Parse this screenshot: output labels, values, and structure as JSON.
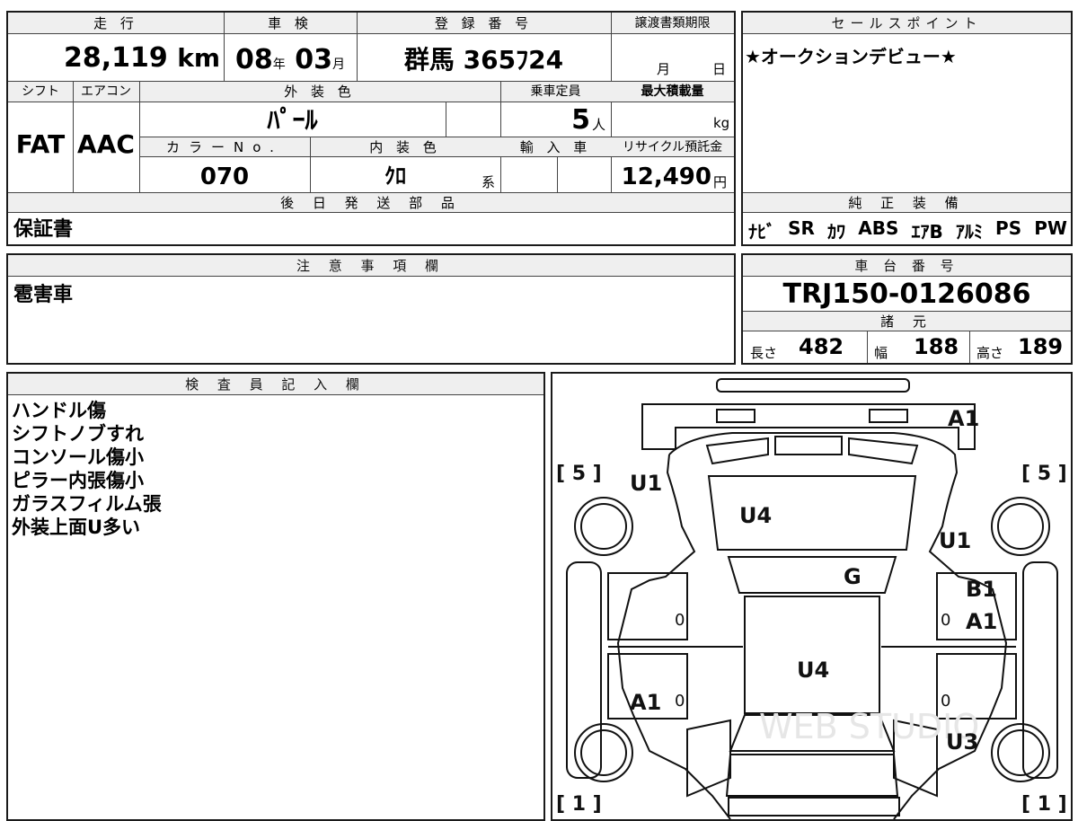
{
  "summary": {
    "mileage_label": "走 行",
    "mileage_value": "28,119",
    "mileage_unit": "km",
    "inspection_label": "車 検",
    "inspection_year": "08",
    "inspection_year_unit": "年",
    "inspection_month": "03",
    "inspection_month_unit": "月",
    "registration_label": "登 録 番 号",
    "registration_value": "群馬 365ﾌ24",
    "transfer_label": "譲渡書類期限",
    "transfer_month_unit": "月",
    "transfer_day_unit": "日"
  },
  "specs": {
    "shift_label": "シフト",
    "shift_value": "FAT",
    "aircon_label": "エアコン",
    "aircon_value": "AAC",
    "exterior_label": "外 装 色",
    "exterior_value": "ﾊﾟｰﾙ",
    "color_no_label": "カラーNo.",
    "color_no_value": "070",
    "interior_label": "内 装 色",
    "interior_value": "ｸﾛ",
    "interior_suffix": "系",
    "capacity_label": "乗車定員",
    "capacity_value": "5",
    "capacity_unit": "人",
    "max_load_label": "最大積載量",
    "max_load_unit": "kg",
    "import_label": "輸 入 車",
    "recycle_label": "リサイクル預託金",
    "recycle_value": "12,490",
    "recycle_unit": "円"
  },
  "sales_point": {
    "title": "セールスポイント",
    "text": "★オークションデビュー★"
  },
  "later_parts": {
    "title": "後 日 発 送 部 品",
    "text": "保証書"
  },
  "equipment": {
    "title": "純 正 装 備",
    "items": [
      "ﾅﾋﾞ",
      "SR",
      "ｶﾜ",
      "ABS",
      "ｴｱB",
      "ｱﾙﾐ",
      "PS",
      "PW"
    ]
  },
  "caution": {
    "title": "注 意 事 項 欄",
    "text": "雹害車"
  },
  "chassis": {
    "title": "車 台 番 号",
    "value": "TRJ150-0126086"
  },
  "dimensions": {
    "title": "諸 元",
    "length_label": "長さ",
    "length_value": "482",
    "width_label": "幅",
    "width_value": "188",
    "height_label": "高さ",
    "height_value": "189"
  },
  "inspector": {
    "title": "検 査 員 記 入 欄",
    "notes": [
      "ハンドル傷",
      "シフトノブすれ",
      "コンソール傷小",
      "ピラー内張傷小",
      "ガラスフィルム張",
      "外装上面U多い"
    ]
  },
  "diagram": {
    "tire_front_left": "[ 5 ]",
    "tire_front_right": "[ 5 ]",
    "tire_rear_left": "[ 1 ]",
    "tire_rear_right": "[ 1 ]",
    "marks": {
      "a1_front": "A1",
      "u1_left": "U1",
      "u4_hood": "U4",
      "u1_right": "U1",
      "g_windshield": "G",
      "b1_right": "B1",
      "a1_right": "A1",
      "u4_roof": "U4",
      "a1_left_rear": "A1",
      "u3_right_rear": "U3"
    },
    "zeros": [
      "0",
      "0",
      "0",
      "0"
    ],
    "watermark": "WEB STUDIO"
  }
}
